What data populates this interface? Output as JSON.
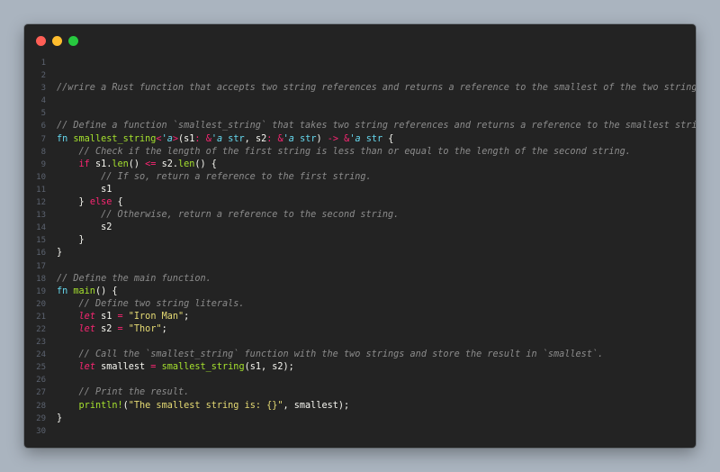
{
  "colors": {
    "background": "#aab4bf",
    "window": "#232323",
    "close_dot": "#ff5f56",
    "minimize_dot": "#ffbd2e",
    "maximize_dot": "#27c93f"
  },
  "lines": [
    {
      "n": "1",
      "tokens": []
    },
    {
      "n": "2",
      "tokens": []
    },
    {
      "n": "3",
      "tokens": [
        [
          "cm",
          "//wrire a Rust function that accepts two string references and returns a reference to the smallest of the two strings."
        ]
      ]
    },
    {
      "n": "4",
      "tokens": []
    },
    {
      "n": "5",
      "tokens": []
    },
    {
      "n": "6",
      "tokens": [
        [
          "cm",
          "// Define a function `smallest_string` that takes two string references and returns a reference to the smallest string."
        ]
      ]
    },
    {
      "n": "7",
      "tokens": [
        [
          "kw",
          "fn "
        ],
        [
          "fnn",
          "smallest_string"
        ],
        [
          "op",
          "<"
        ],
        [
          "ty",
          "'a"
        ],
        [
          "op",
          ">"
        ],
        [
          "var",
          "("
        ],
        [
          "var",
          "s1"
        ],
        [
          "op",
          ": "
        ],
        [
          "op",
          "&"
        ],
        [
          "ty",
          "'a"
        ],
        [
          "var",
          " "
        ],
        [
          "kw",
          "str"
        ],
        [
          "var",
          ", "
        ],
        [
          "var",
          "s2"
        ],
        [
          "op",
          ": "
        ],
        [
          "op",
          "&"
        ],
        [
          "ty",
          "'a"
        ],
        [
          "var",
          " "
        ],
        [
          "kw",
          "str"
        ],
        [
          "var",
          ") "
        ],
        [
          "op",
          "->"
        ],
        [
          "var",
          " "
        ],
        [
          "op",
          "&"
        ],
        [
          "ty",
          "'a"
        ],
        [
          "var",
          " "
        ],
        [
          "kw",
          "str"
        ],
        [
          "var",
          " {"
        ]
      ]
    },
    {
      "n": "8",
      "tokens": [
        [
          "var",
          "    "
        ],
        [
          "cm",
          "// Check if the length of the first string is less than or equal to the length of the second string."
        ]
      ]
    },
    {
      "n": "9",
      "tokens": [
        [
          "var",
          "    "
        ],
        [
          "kw2",
          "if "
        ],
        [
          "var",
          "s1."
        ],
        [
          "fnn",
          "len"
        ],
        [
          "var",
          "() "
        ],
        [
          "op",
          "<="
        ],
        [
          "var",
          " s2."
        ],
        [
          "fnn",
          "len"
        ],
        [
          "var",
          "() {"
        ]
      ]
    },
    {
      "n": "10",
      "tokens": [
        [
          "var",
          "        "
        ],
        [
          "cm",
          "// If so, return a reference to the first string."
        ]
      ]
    },
    {
      "n": "11",
      "tokens": [
        [
          "var",
          "        s1"
        ]
      ]
    },
    {
      "n": "12",
      "tokens": [
        [
          "var",
          "    } "
        ],
        [
          "kw2",
          "else"
        ],
        [
          "var",
          " {"
        ]
      ]
    },
    {
      "n": "13",
      "tokens": [
        [
          "var",
          "        "
        ],
        [
          "cm",
          "// Otherwise, return a reference to the second string."
        ]
      ]
    },
    {
      "n": "14",
      "tokens": [
        [
          "var",
          "        s2"
        ]
      ]
    },
    {
      "n": "15",
      "tokens": [
        [
          "var",
          "    }"
        ]
      ]
    },
    {
      "n": "16",
      "tokens": [
        [
          "var",
          "}"
        ]
      ]
    },
    {
      "n": "17",
      "tokens": []
    },
    {
      "n": "18",
      "tokens": [
        [
          "cm",
          "// Define the main function."
        ]
      ]
    },
    {
      "n": "19",
      "tokens": [
        [
          "kw",
          "fn "
        ],
        [
          "fnn",
          "main"
        ],
        [
          "var",
          "() {"
        ]
      ]
    },
    {
      "n": "20",
      "tokens": [
        [
          "var",
          "    "
        ],
        [
          "cm",
          "// Define two string literals."
        ]
      ]
    },
    {
      "n": "21",
      "tokens": [
        [
          "var",
          "    "
        ],
        [
          "let",
          "let"
        ],
        [
          "var",
          " s1 "
        ],
        [
          "op",
          "="
        ],
        [
          "var",
          " "
        ],
        [
          "str",
          "\"Iron Man\""
        ],
        [
          "var",
          ";"
        ]
      ]
    },
    {
      "n": "22",
      "tokens": [
        [
          "var",
          "    "
        ],
        [
          "let",
          "let"
        ],
        [
          "var",
          " s2 "
        ],
        [
          "op",
          "="
        ],
        [
          "var",
          " "
        ],
        [
          "str",
          "\"Thor\""
        ],
        [
          "var",
          ";"
        ]
      ]
    },
    {
      "n": "23",
      "tokens": []
    },
    {
      "n": "24",
      "tokens": [
        [
          "var",
          "    "
        ],
        [
          "cm",
          "// Call the `smallest_string` function with the two strings and store the result in `smallest`."
        ]
      ]
    },
    {
      "n": "25",
      "tokens": [
        [
          "var",
          "    "
        ],
        [
          "let",
          "let"
        ],
        [
          "var",
          " smallest "
        ],
        [
          "op",
          "="
        ],
        [
          "var",
          " "
        ],
        [
          "fnn",
          "smallest_string"
        ],
        [
          "var",
          "(s1, s2);"
        ]
      ]
    },
    {
      "n": "26",
      "tokens": []
    },
    {
      "n": "27",
      "tokens": [
        [
          "var",
          "    "
        ],
        [
          "cm",
          "// Print the result."
        ]
      ]
    },
    {
      "n": "28",
      "tokens": [
        [
          "var",
          "    "
        ],
        [
          "fnn",
          "println!"
        ],
        [
          "var",
          "("
        ],
        [
          "str",
          "\"The smallest string is: {}\""
        ],
        [
          "var",
          ", smallest);"
        ]
      ]
    },
    {
      "n": "29",
      "tokens": [
        [
          "var",
          "}"
        ]
      ]
    },
    {
      "n": "30",
      "tokens": []
    }
  ]
}
